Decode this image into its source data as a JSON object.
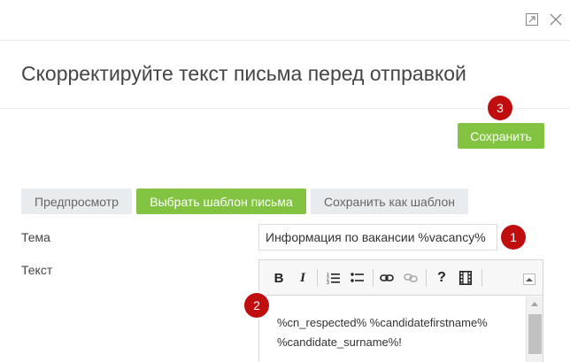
{
  "window": {
    "expand_icon": "expand-icon",
    "close_icon": "close-icon"
  },
  "dialog": {
    "title": "Скорректируйте текст письма перед отправкой",
    "save_label": "Сохранить"
  },
  "tabs": [
    {
      "label": "Предпросмотр",
      "active": false
    },
    {
      "label": "Выбрать шаблон письма",
      "active": true
    },
    {
      "label": "Сохранить как шаблон",
      "active": false
    }
  ],
  "form": {
    "subject_label": "Тема",
    "subject_value": "Информация по вакансии %vacancy%",
    "text_label": "Текст",
    "body_line1": "%cn_respected% %candidatefirstname%",
    "body_line2": "%candidate_surname%!"
  },
  "editor_toolbar": [
    {
      "name": "bold",
      "icon": "bold-icon",
      "glyph": "B"
    },
    {
      "name": "italic",
      "icon": "italic-icon",
      "glyph": "I"
    },
    {
      "name": "numbered-list",
      "icon": "numbered-list-icon"
    },
    {
      "name": "bulleted-list",
      "icon": "bulleted-list-icon"
    },
    {
      "name": "link",
      "icon": "link-icon"
    },
    {
      "name": "unlink",
      "icon": "unlink-icon"
    },
    {
      "name": "help",
      "icon": "help-icon",
      "glyph": "?"
    },
    {
      "name": "media",
      "icon": "film-icon"
    }
  ],
  "annotations": {
    "badge_1": "1",
    "badge_2": "2",
    "badge_3": "3"
  },
  "colors": {
    "accent_green": "#82c341",
    "badge_red": "#c00e0e",
    "tab_grey": "#e9ecef"
  }
}
